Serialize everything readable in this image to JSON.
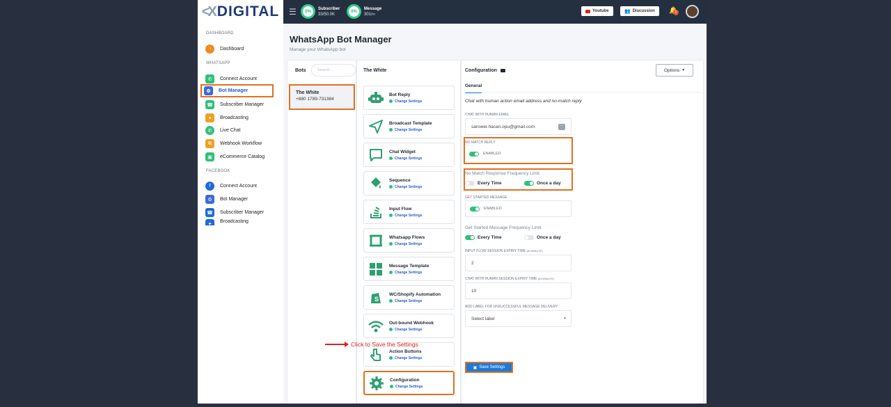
{
  "brand": {
    "logo_text": "DIGITAL"
  },
  "topbar": {
    "subscriber": {
      "percent": "0%",
      "label": "Subscriber",
      "value": "33/50.0K"
    },
    "message": {
      "percent": "0%",
      "label": "Message",
      "value": "301/∞"
    },
    "youtube_label": "Youtube",
    "discussion_label": "Discussion",
    "notification_count": "0"
  },
  "sidebar": {
    "section_dashboard": "DASHBOARD",
    "dashboard": "Dashboard",
    "section_whatsapp": "WHATSAPP",
    "wa_items": [
      "Connect Account",
      "Bot Manager",
      "Subscriber Manager",
      "Broadcasting",
      "Live Chat",
      "Webhook Workflow",
      "eCommerce Catalog"
    ],
    "section_facebook": "FACEBOOK",
    "fb_items": [
      "Connect Account",
      "Bot Manager",
      "Subscriber Manager",
      "Broadcasting"
    ]
  },
  "page": {
    "title": "WhatsApp Bot Manager",
    "subtitle": "Manage your WhatsApp bot"
  },
  "bots": {
    "label": "Bots",
    "search_placeholder": "Search...",
    "selected_name": "The White",
    "selected_phone": "+880 1789-731384"
  },
  "features": {
    "header": "The White",
    "change_label": "Change Settings",
    "items": [
      "Bot Reply",
      "Broadcast Template",
      "Chat Widget",
      "Sequence",
      "Input Flow",
      "Whatsapp Flows",
      "Message Template",
      "WC/Shopify Automation",
      "Out-bound Webhook",
      "Action Buttons",
      "Configuration"
    ]
  },
  "config": {
    "title": "Configuration",
    "options_label": "Options",
    "tab_general": "General",
    "description": "Chat with human action email address and no-match reply",
    "email_label": "CHAT WITH HUMAN EMAIL",
    "email_value": "sarower.hacan.opu@gmail.com",
    "no_match_label": "NO MATCH REPLY",
    "enabled_text": "ENABLED",
    "no_match_freq_label": "No Match Response Frequency Limit",
    "every_time": "Every Time",
    "once_a_day": "Once a day",
    "get_started_label": "GET STARTED MESSAGE",
    "get_started_freq_label": "Get Started Message Frequency Limit",
    "input_flow_label": "INPUT FLOW SESSION EXPIRY TIME",
    "input_flow_unit": "(IN MINUTE)",
    "input_flow_value": "2",
    "chat_human_label": "CHAT WITH HUMAN SESSION EXPIRY TIME",
    "chat_human_unit": "(IN MINUTE)",
    "chat_human_value": "10",
    "add_label_label": "ADD LABEL FOR UNSUCCESSFUL MESSAGE DELIVERY",
    "select_placeholder": "Select label",
    "save_label": "Save Settings"
  },
  "annotation": {
    "text": "Click to Save the Settings"
  },
  "colors": {
    "accent": "#1e7ad8",
    "highlight": "#e07020",
    "toggle_on": "#2fc07a",
    "annotation": "#e02020",
    "topbar": "#243040"
  }
}
